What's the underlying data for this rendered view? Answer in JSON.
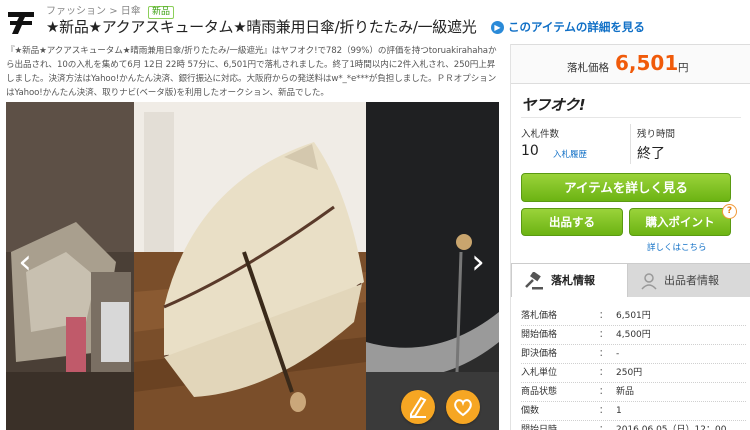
{
  "breadcrumb": {
    "category": "ファッション",
    "sep": ">",
    "sub": "日傘",
    "badge": "新品"
  },
  "title": "★新品★アクアスキュータム★晴雨兼用日傘/折りたたみ/一級遮光",
  "detail_link": "このアイテムの詳細を見る",
  "description": "『★新品★アクアスキュータム★晴雨兼用日傘/折りたたみ/一級遮光』はヤフオク!で782（99%）の評価を持つtoruakirahahaから出品され、10の入札を集めて6月 12日 22時 57分に、6,501円で落札されました。終了1時間以内に2件入札され、250円上昇しました。決済方法はYahoo!かんたん決済、銀行振込に対応。大阪府からの発送料はw*_*e***が負担しました。ＰＲオプションはYahoo!かんたん決済、取りナビ(ベータ版)を利用したオークション、新品でした。",
  "gallery": {
    "prev_icon": "‹",
    "next_icon": "›"
  },
  "price": {
    "label": "落札価格",
    "value": "6,501",
    "unit": "円"
  },
  "brand": "ヤフオク!",
  "stats": {
    "bids_label": "入札件数",
    "bids_value": "10",
    "history_link": "入札履歴",
    "remaining_label": "残り時間",
    "remaining_value": "終了"
  },
  "buttons": {
    "details": "アイテムを詳しく見る",
    "sell": "出品する",
    "buy_points": "購入ポイント",
    "help": "?",
    "more_link": "詳しくはこちら"
  },
  "tabs": {
    "active": "落札情報",
    "inactive": "出品者情報"
  },
  "info_rows": [
    {
      "key": "落札価格",
      "colon": "：",
      "value": "6,501円"
    },
    {
      "key": "開始価格",
      "colon": "：",
      "value": "4,500円"
    },
    {
      "key": "即決価格",
      "colon": "：",
      "value": "-"
    },
    {
      "key": "入札単位",
      "colon": "：",
      "value": "250円"
    },
    {
      "key": "商品状態",
      "colon": "：",
      "value": "新品"
    },
    {
      "key": "個数",
      "colon": "：",
      "value": "1"
    },
    {
      "key": "開始日時",
      "colon": "：",
      "value": "2016.06.05（日）12：00"
    }
  ],
  "colors": {
    "accent_orange": "#f05a0a",
    "green": "#6cb313",
    "link": "#0f6fc6",
    "fab": "#f6a623"
  }
}
